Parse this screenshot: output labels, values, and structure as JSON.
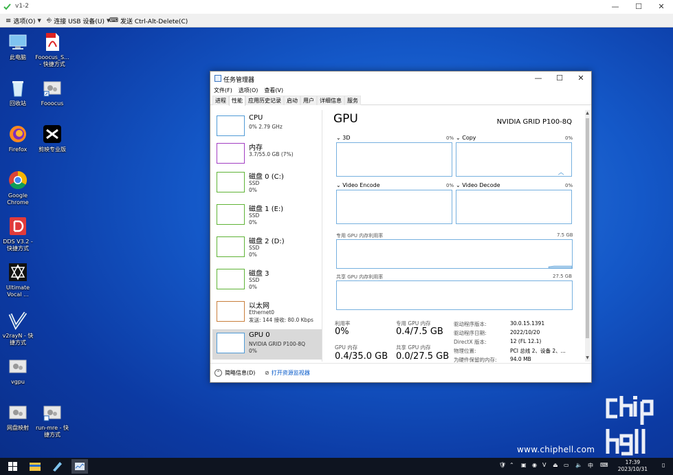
{
  "viewer": {
    "title": "v1-2",
    "toolbar": {
      "options": "选项(O)",
      "usb": "连接 USB 设备(U)",
      "cad": "发送 Ctrl-Alt-Delete(C)"
    }
  },
  "desktop_icons": [
    {
      "label": "此电脑",
      "icon": "computer-icon"
    },
    {
      "label": "Fooocus_S... - 快捷方式",
      "icon": "pdf-icon"
    },
    {
      "label": "回收站",
      "icon": "recycle-bin-icon"
    },
    {
      "label": "Fooocus",
      "icon": "shortcut-icon"
    },
    {
      "label": "Firefox",
      "icon": "firefox-icon"
    },
    {
      "label": "剪映专业版",
      "icon": "capcut-icon"
    },
    {
      "label": "Google Chrome",
      "icon": "chrome-icon"
    },
    {
      "label": "DDS V3.2 - 快捷方式",
      "icon": "dds-icon"
    },
    {
      "label": "Ultimate Vocal ...",
      "icon": "uvr-icon"
    },
    {
      "label": "v2rayN - 快捷方式",
      "icon": "v2rayn-icon"
    },
    {
      "label": "vgpu",
      "icon": "shortcut-icon"
    },
    {
      "label": "网盘映射",
      "icon": "shortcut-icon"
    },
    {
      "label": "run-mre - 快捷方式",
      "icon": "shortcut-icon"
    }
  ],
  "task_manager": {
    "title": "任务管理器",
    "menu": [
      "文件(F)",
      "选项(O)",
      "查看(V)"
    ],
    "tabs": [
      "进程",
      "性能",
      "应用历史记录",
      "启动",
      "用户",
      "详细信息",
      "服务"
    ],
    "active_tab": "性能",
    "resources": [
      {
        "name": "CPU",
        "l1": "0% 2.79 GHz",
        "l2": "",
        "color": "#4f9ad6"
      },
      {
        "name": "内存",
        "l1": "3.7/55.0 GB (7%)",
        "l2": "",
        "color": "#a23dc2"
      },
      {
        "name": "磁盘 0 (C:)",
        "l1": "SSD",
        "l2": "0%",
        "color": "#5fb336"
      },
      {
        "name": "磁盘 1 (E:)",
        "l1": "SSD",
        "l2": "0%",
        "color": "#5fb336"
      },
      {
        "name": "磁盘 2 (D:)",
        "l1": "SSD",
        "l2": "0%",
        "color": "#5fb336"
      },
      {
        "name": "磁盘 3",
        "l1": "SSD",
        "l2": "0%",
        "color": "#5fb336"
      },
      {
        "name": "以太网",
        "l1": "Ethernet0",
        "l2": "发送: 144 接收: 80.0 Kbps",
        "color": "#c87e3b"
      },
      {
        "name": "GPU 0",
        "l1": "NVIDIA GRID P100-8Q",
        "l2": "0%",
        "color": "#4f9ad6"
      }
    ],
    "gpu": {
      "title": "GPU",
      "model": "NVIDIA GRID P100-8Q",
      "engines": [
        {
          "name": "3D",
          "pct": "0%"
        },
        {
          "name": "Copy",
          "pct": "0%"
        },
        {
          "name": "Video Encode",
          "pct": "0%"
        },
        {
          "name": "Video Decode",
          "pct": "0%"
        }
      ],
      "dedicated_label": "专用 GPU 内存利用率",
      "dedicated_max": "7.5 GB",
      "shared_label": "共享 GPU 内存利用率",
      "shared_max": "27.5 GB",
      "stats": {
        "util_label": "利用率",
        "util": "0%",
        "ded_label": "专用 GPU 内存",
        "ded": "0.4/7.5 GB",
        "mem_label": "GPU 内存",
        "mem": "0.4/35.0 GB",
        "shr_label": "共享 GPU 内存",
        "shr": "0.0/27.5 GB"
      },
      "props": [
        {
          "k": "驱动程序版本:",
          "v": "30.0.15.1391"
        },
        {
          "k": "驱动程序日期:",
          "v": "2022/10/20"
        },
        {
          "k": "DirectX 版本:",
          "v": "12 (FL 12.1)"
        },
        {
          "k": "物理位置:",
          "v": "PCI 总线 2、设备 2、..."
        },
        {
          "k": "为硬件保留的内存:",
          "v": "94.0 MB"
        }
      ]
    },
    "footer": {
      "details": "简略信息(D)",
      "monitor": "打开资源监视器"
    }
  },
  "taskbar": {
    "ime": "中",
    "time": "17:39",
    "date": "2023/10/31"
  },
  "watermark": {
    "url": "www.chiphell.com",
    "logo_text": "chip hell"
  },
  "colors": {
    "accent": "#4f9ad6",
    "graph_border": "#76b0df"
  }
}
